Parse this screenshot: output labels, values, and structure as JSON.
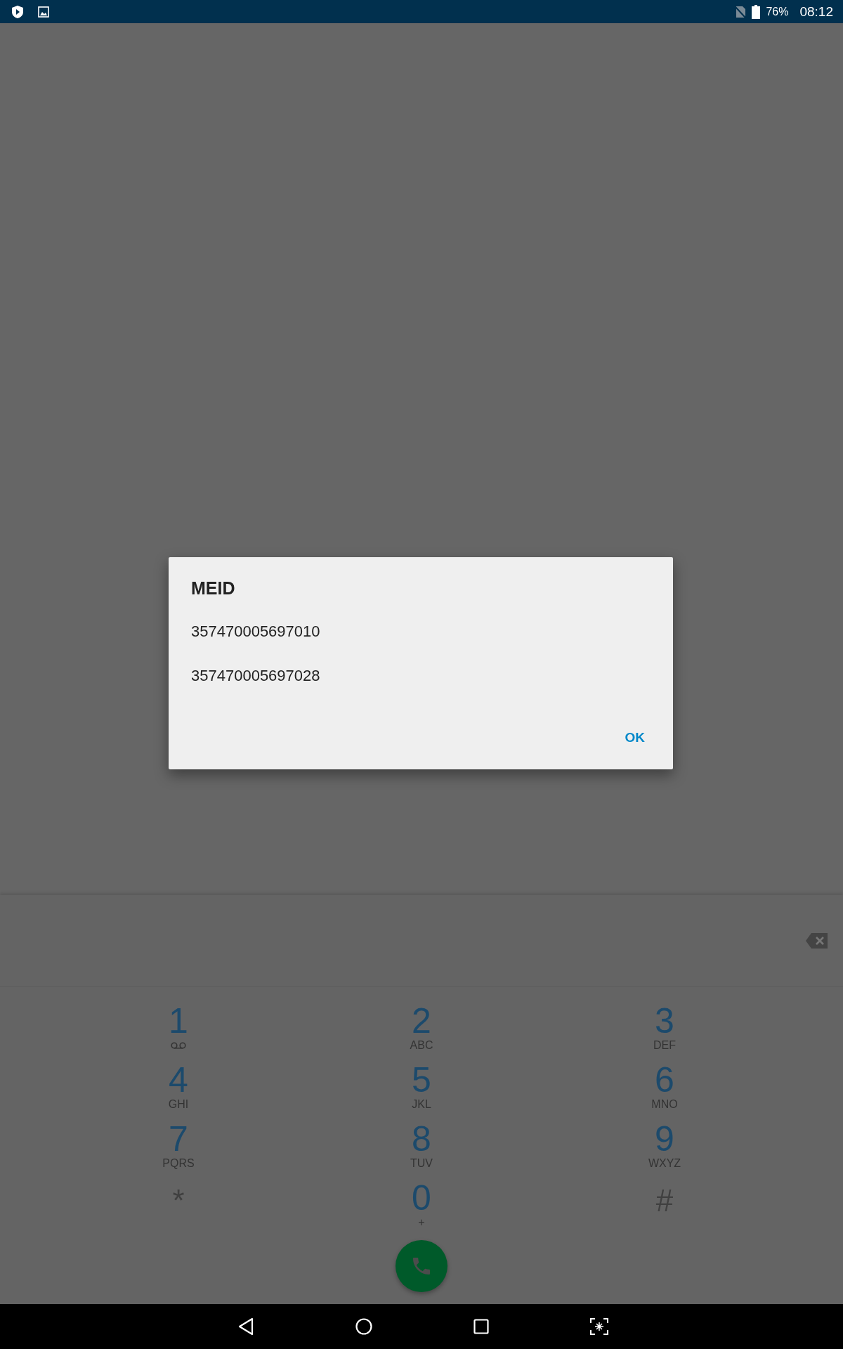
{
  "status_bar": {
    "battery": "76%",
    "time": "08:12"
  },
  "dialog": {
    "title": "MEID",
    "lines": [
      "357470005697010",
      "357470005697028"
    ],
    "button": "OK"
  },
  "dialpad": {
    "keys": [
      {
        "kind": "voicemail",
        "digit": "1"
      },
      {
        "kind": "letters",
        "digit": "2",
        "letters": "ABC"
      },
      {
        "kind": "letters",
        "digit": "3",
        "letters": "DEF"
      },
      {
        "kind": "letters",
        "digit": "4",
        "letters": "GHI"
      },
      {
        "kind": "letters",
        "digit": "5",
        "letters": "JKL"
      },
      {
        "kind": "letters",
        "digit": "6",
        "letters": "MNO"
      },
      {
        "kind": "letters",
        "digit": "7",
        "letters": "PQRS"
      },
      {
        "kind": "letters",
        "digit": "8",
        "letters": "TUV"
      },
      {
        "kind": "letters",
        "digit": "9",
        "letters": "WXYZ"
      },
      {
        "kind": "symbol",
        "digit": "*"
      },
      {
        "kind": "letters",
        "digit": "0",
        "letters": "+"
      },
      {
        "kind": "symbol",
        "digit": "#"
      }
    ]
  }
}
